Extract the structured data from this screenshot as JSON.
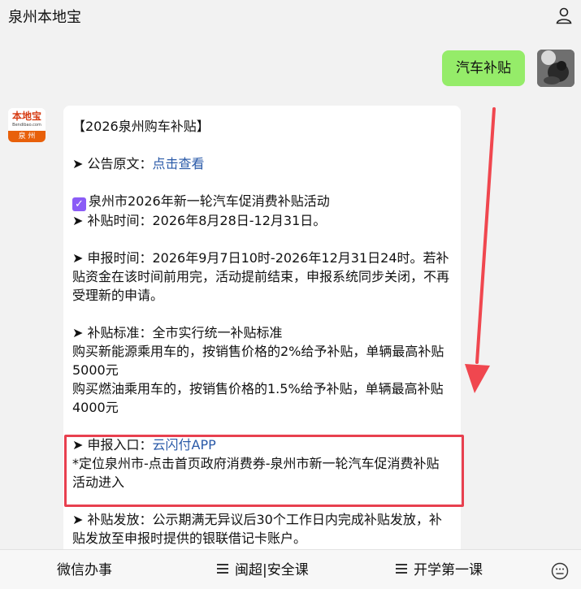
{
  "header": {
    "title": "泉州本地宝",
    "user_icon": "user-icon"
  },
  "user_message": {
    "text": "汽车补贴",
    "avatar": "user-avatar"
  },
  "bot": {
    "avatar_logo_main": "本地宝",
    "avatar_logo_sub": "Bendibao.com",
    "avatar_logo_city": "泉 州",
    "lines": {
      "l1": "【2026泉州购车补贴】",
      "l2_prefix": "➤ 公告原文：",
      "l2_link": "点击查看",
      "l3": "泉州市2026年新一轮汽车促消费补贴活动",
      "l4": "➤ 补贴时间：2026年8月28日-12月31日。",
      "l5": "➤ 申报时间：2026年9月7日10时-2026年12月31日24时。若补贴资金在该时间前用完，活动提前结束，申报系统同步关闭，不再受理新的申请。",
      "l6": "➤ 补贴标准：全市实行统一补贴标准",
      "l7": "购买新能源乘用车的，按销售价格的2%给予补贴，单辆最高补贴5000元",
      "l8": "购买燃油乘用车的，按销售价格的1.5%给予补贴，单辆最高补贴4000元",
      "l9_prefix": "➤ 申报入口：",
      "l9_link": "云闪付APP",
      "l10": "*定位泉州市-点击首页政府消费券-泉州市新一轮汽车促消费补贴活动进入",
      "l11": "➤ 补贴发放：公示期满无异议后30个工作日内完成补贴发放，补贴发放至申报时提供的银联借记卡账户。"
    }
  },
  "annotations": {
    "highlight_color": "#e8404f",
    "arrow_color": "#f0474f"
  },
  "bottom_menu": {
    "item1": "微信办事",
    "item2": "闽超|安全课",
    "item3": "开学第一课",
    "keyboard_icon": "keyboard-icon"
  }
}
